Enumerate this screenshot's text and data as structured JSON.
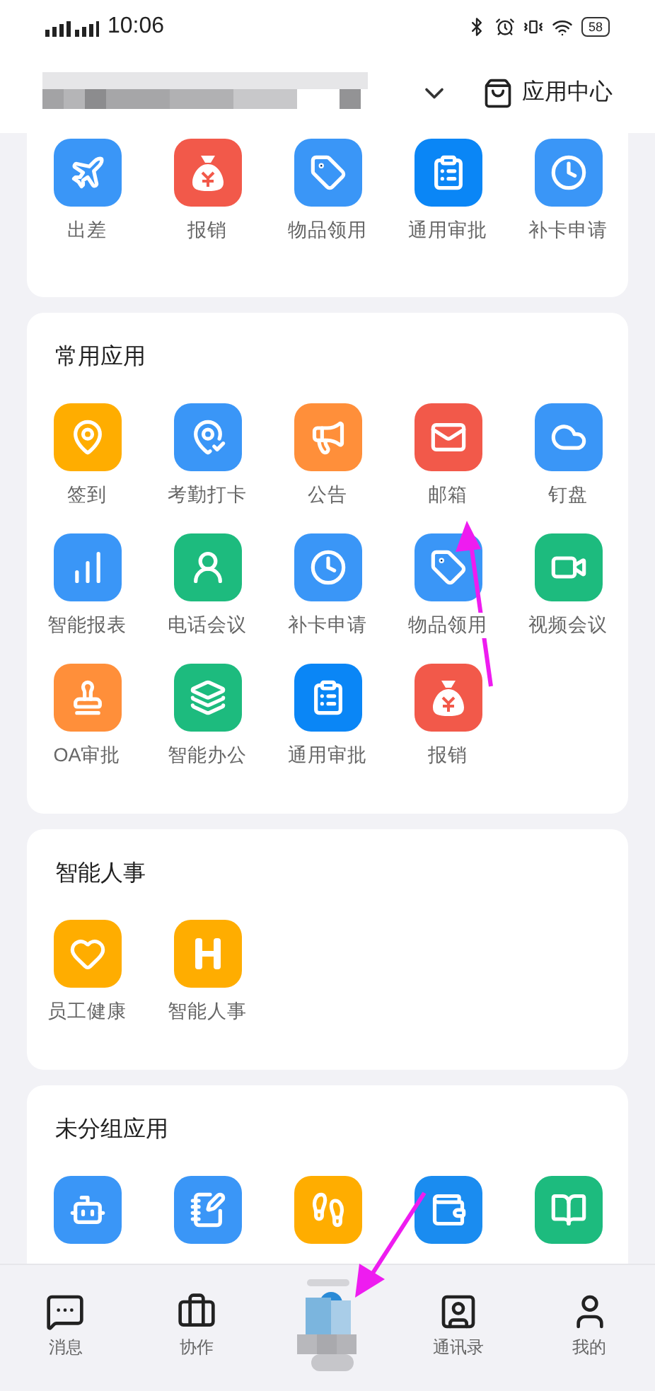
{
  "status_bar": {
    "time": "10:06",
    "battery": "58"
  },
  "header": {
    "app_center": "应用中心"
  },
  "sections": [
    {
      "cut": true,
      "apps": [
        {
          "label": "出差",
          "kind": "plane",
          "color": "#3a96f7"
        },
        {
          "label": "报销",
          "kind": "money-bag",
          "color": "#f2594a"
        },
        {
          "label": "物品领用",
          "kind": "tag",
          "color": "#3a96f7"
        },
        {
          "label": "通用审批",
          "kind": "clipboard",
          "color": "#0a86f6"
        },
        {
          "label": "补卡申请",
          "kind": "clock",
          "color": "#3a96f7"
        }
      ]
    },
    {
      "title": "常用应用",
      "apps": [
        {
          "label": "签到",
          "kind": "pin",
          "color": "#ffad00"
        },
        {
          "label": "考勤打卡",
          "kind": "check-pin",
          "color": "#3a96f7"
        },
        {
          "label": "公告",
          "kind": "megaphone",
          "color": "#ff8f3a"
        },
        {
          "label": "邮箱",
          "kind": "mail",
          "color": "#f2594a"
        },
        {
          "label": "钉盘",
          "kind": "cloud",
          "color": "#3a96f7"
        },
        {
          "label": "智能报表",
          "kind": "chart",
          "color": "#3a96f7"
        },
        {
          "label": "电话会议",
          "kind": "user-clock",
          "color": "#1dbb7e"
        },
        {
          "label": "补卡申请",
          "kind": "clock",
          "color": "#3a96f7"
        },
        {
          "label": "物品领用",
          "kind": "tag",
          "color": "#3a96f7"
        },
        {
          "label": "视频会议",
          "kind": "video",
          "color": "#1dbb7e"
        },
        {
          "label": "OA审批",
          "kind": "stamp",
          "color": "#ff8f3a"
        },
        {
          "label": "智能办公",
          "kind": "layers",
          "color": "#1dbb7e"
        },
        {
          "label": "通用审批",
          "kind": "clipboard",
          "color": "#0a86f6"
        },
        {
          "label": "报销",
          "kind": "money-bag",
          "color": "#f2594a"
        }
      ]
    },
    {
      "title": "智能人事",
      "apps": [
        {
          "label": "员工健康",
          "kind": "heart",
          "color": "#ffad00"
        },
        {
          "label": "智能人事",
          "kind": "h-mark",
          "color": "#ffad00"
        }
      ]
    },
    {
      "title": "未分组应用",
      "apps": [
        {
          "kind": "bot",
          "color": "#3a96f7"
        },
        {
          "kind": "notebook",
          "color": "#3a96f7"
        },
        {
          "kind": "runner",
          "color": "#ffad00"
        },
        {
          "kind": "wallet",
          "color": "#1a8cf0"
        },
        {
          "kind": "book",
          "color": "#1dbb7e"
        }
      ]
    }
  ],
  "tabs": [
    {
      "kind": "message",
      "label": "消息"
    },
    {
      "kind": "briefcase",
      "label": "协作"
    },
    {
      "kind": "hidden"
    },
    {
      "kind": "contacts",
      "label": "通讯录"
    },
    {
      "kind": "user",
      "label": "我的"
    }
  ]
}
